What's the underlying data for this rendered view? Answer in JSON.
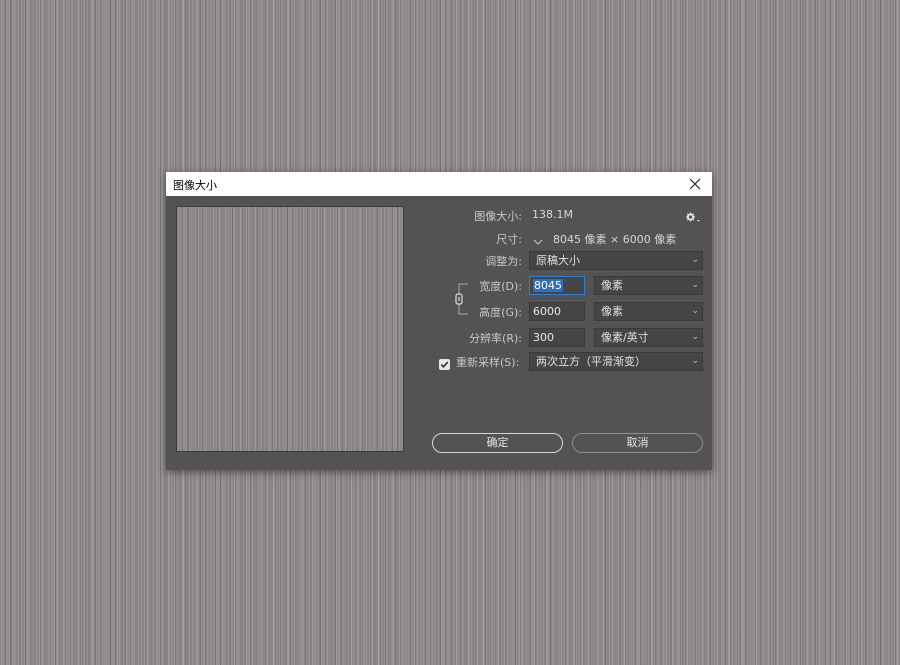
{
  "dialog": {
    "title": "图像大小",
    "image_size_label": "图像大小:",
    "image_size_value": "138.1M",
    "dimensions_label": "尺寸:",
    "dimensions_value": "8045 像素  ×  6000 像素",
    "fit_to_label": "调整为:",
    "fit_to_value": "原稿大小",
    "width_label": "宽度(D):",
    "width_value": "8045",
    "width_unit": "像素",
    "height_label": "高度(G):",
    "height_value": "6000",
    "height_unit": "像素",
    "resolution_label": "分辨率(R):",
    "resolution_value": "300",
    "resolution_unit": "像素/英寸",
    "resample_label": "重新采样(S):",
    "resample_checked": true,
    "resample_value": "两次立方（平滑渐变）",
    "ok_label": "确定",
    "cancel_label": "取消"
  },
  "colors": {
    "dialog_bg": "#535353",
    "field_bg": "#454545",
    "focus_border": "#2f7fd3",
    "selection": "#2f6fc0"
  },
  "icons": [
    "close-icon",
    "gear-icon",
    "chevron-down-icon",
    "chain-link-icon",
    "checkbox-checked-icon"
  ]
}
